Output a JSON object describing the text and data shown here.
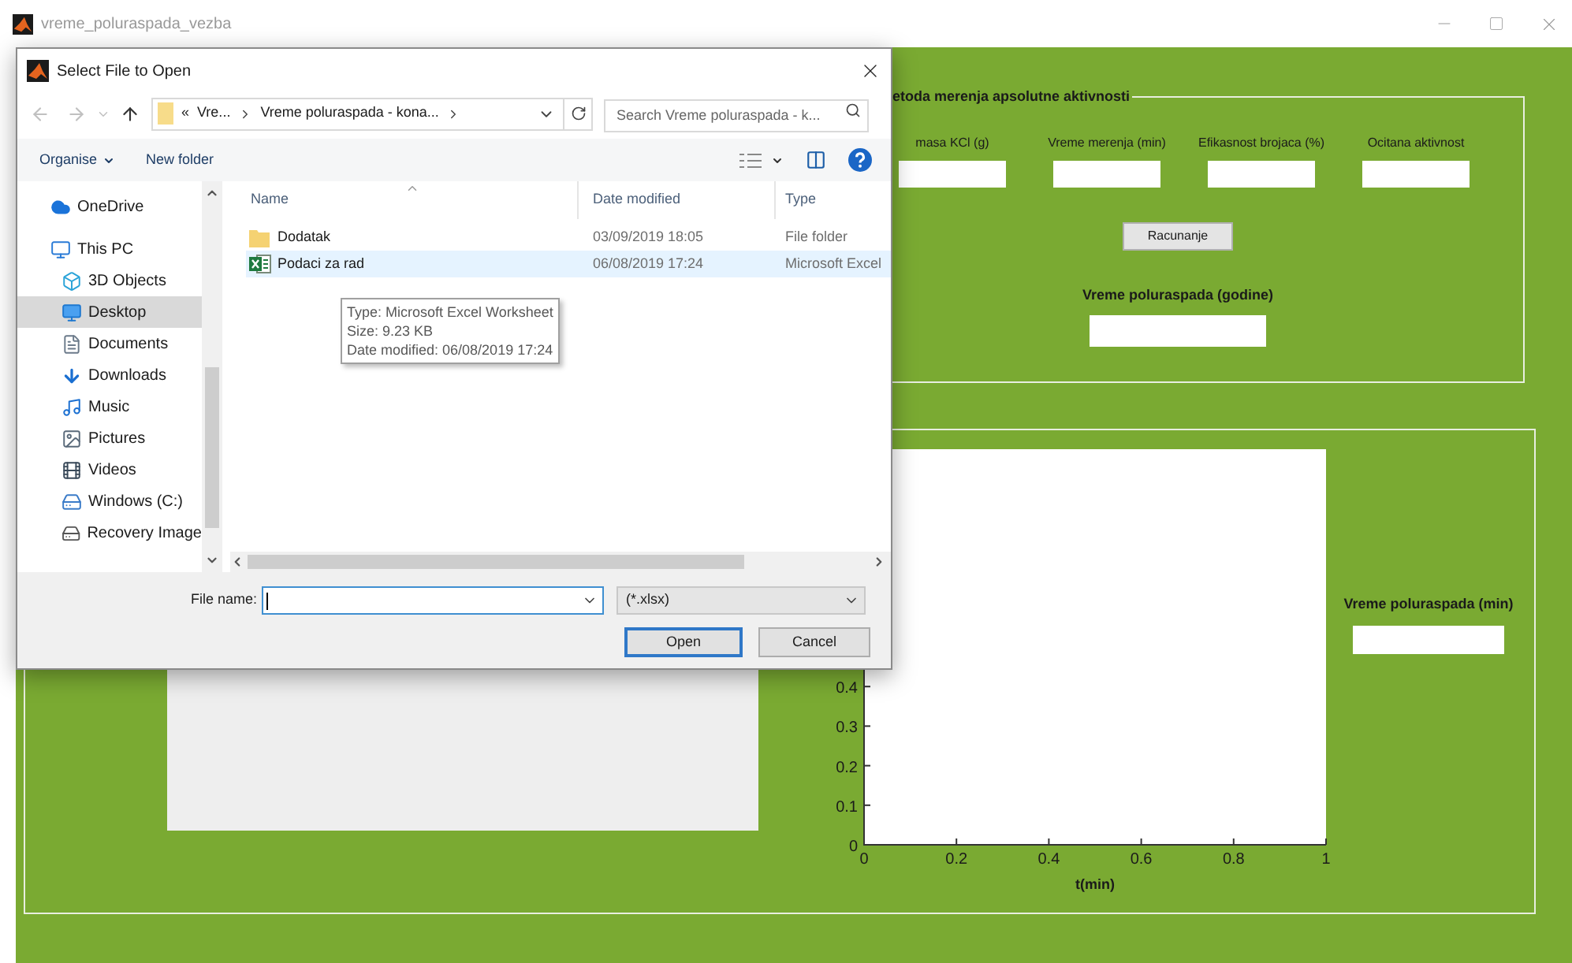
{
  "window": {
    "title": "vreme_poluraspada_vezba"
  },
  "top_panel": {
    "title": "etoda merenja apsolutne aktivnosti",
    "fields": [
      {
        "label": "masa KCl (g)"
      },
      {
        "label": "Vreme merenja (min)"
      },
      {
        "label": "Efikasnost brojaca (%)"
      },
      {
        "label": "Ocitana aktivnost"
      }
    ],
    "button": "Racunanje",
    "result_label": "Vreme poluraspada (godine)"
  },
  "bottom_panel": {
    "chart_data": {
      "type": "line",
      "xlabel": "t(min)",
      "xlim": [
        0,
        1
      ],
      "ylim": [
        0,
        1
      ],
      "xticks": [
        0,
        0.2,
        0.4,
        0.6,
        0.8,
        1
      ],
      "yticks": [
        0,
        0.1,
        0.2,
        0.3,
        0.4
      ]
    },
    "result_label": "Vreme poluraspada (min)"
  },
  "dialog": {
    "title": "Select File to Open",
    "breadcrumb": [
      "«",
      "Vre...",
      "Vreme poluraspada - kona..."
    ],
    "search": {
      "placeholder": "Search Vreme poluraspada - k..."
    },
    "toolbar": [
      "Organise",
      "New folder"
    ],
    "nav": [
      {
        "label": "OneDrive",
        "kind": "cloud",
        "selected": false
      },
      {
        "label": "This PC",
        "kind": "computer",
        "selected": false,
        "children": [
          {
            "label": "3D Objects",
            "kind": "objects",
            "selected": false
          },
          {
            "label": "Desktop",
            "kind": "desktop",
            "selected": true
          },
          {
            "label": "Documents",
            "kind": "documents",
            "selected": false
          },
          {
            "label": "Downloads",
            "kind": "downloads",
            "selected": false
          },
          {
            "label": "Music",
            "kind": "music",
            "selected": false
          },
          {
            "label": "Pictures",
            "kind": "pictures",
            "selected": false
          },
          {
            "label": "Videos",
            "kind": "videos",
            "selected": false
          },
          {
            "label": "Windows (C:)",
            "kind": "drive",
            "selected": false
          },
          {
            "label": "Recovery Image",
            "kind": "recovery",
            "selected": false
          }
        ]
      }
    ],
    "columns": [
      "Name",
      "Date modified",
      "Type"
    ],
    "files": [
      {
        "name": "Dodatak",
        "date": "03/09/2019 18:05",
        "type": "File folder",
        "kind": "folder",
        "selected": false
      },
      {
        "name": "Podaci za rad",
        "date": "06/08/2019 17:24",
        "type": "Microsoft Excel",
        "kind": "excel",
        "selected": true
      }
    ],
    "tooltip": [
      "Type: Microsoft Excel Worksheet",
      "Size: 9.23 KB",
      "Date modified: 06/08/2019 17:24"
    ],
    "file_name_label": "File name:",
    "filter": "(*.xlsx)",
    "buttons": [
      {
        "label": "Open",
        "default": true
      },
      {
        "label": "Cancel",
        "default": false
      }
    ]
  }
}
